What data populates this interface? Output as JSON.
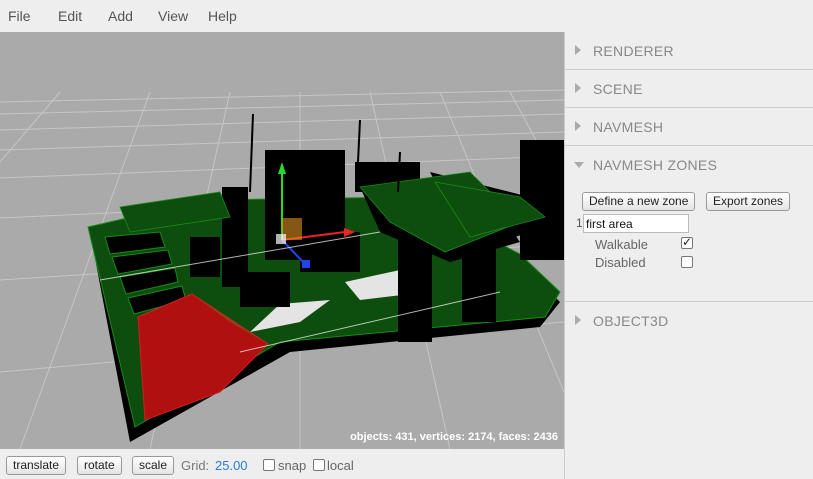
{
  "menubar": {
    "items": [
      "File",
      "Edit",
      "Add",
      "View",
      "Help"
    ]
  },
  "viewport": {
    "stats": "objects: 431, vertices: 2174, faces: 2436"
  },
  "sidebar": {
    "panels": {
      "renderer": "RENDERER",
      "scene": "SCENE",
      "navmesh": "NAVMESH",
      "navmesh_zones": "NAVMESH ZONES",
      "object3d": "OBJECT3D"
    },
    "zones": {
      "define_button": "Define a new zone",
      "export_button": "Export zones",
      "index": "1",
      "name_value": "first area",
      "walkable_label": "Walkable",
      "walkable_checked": true,
      "disabled_label": "Disabled",
      "disabled_checked": false
    }
  },
  "toolbar": {
    "translate": "translate",
    "rotate": "rotate",
    "scale": "scale",
    "grid_label": "Grid:",
    "grid_value": "25.00",
    "snap_label": "snap",
    "snap_checked": false,
    "local_label": "local",
    "local_checked": false
  },
  "colors": {
    "viewport_bg": "#aaaaaa",
    "navmesh_green": "#0d4d0d",
    "zone_red": "#b01010",
    "grid_blue": "#2a7bd6"
  }
}
